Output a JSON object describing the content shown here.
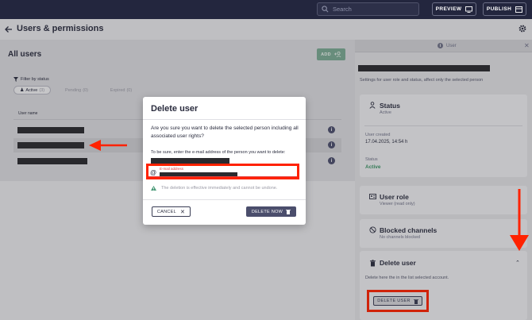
{
  "topbar": {
    "search_placeholder": "Search",
    "preview_label": "PREVIEW",
    "publish_label": "PUBLISH"
  },
  "header": {
    "title": "Users & permissions"
  },
  "list": {
    "title": "All users",
    "add_label": "ADD",
    "filter_label": "Filter by status",
    "chips": [
      {
        "label": "Active",
        "count": "(3)"
      },
      {
        "label": "Pending",
        "count": "(0)"
      },
      {
        "label": "Expired",
        "count": "(0)"
      }
    ],
    "column_header": "User name"
  },
  "right_panel": {
    "tab_label": "User",
    "description": "Settings for user role and status, affect only the selected person",
    "status": {
      "title": "Status",
      "subtitle": "Active",
      "created_label": "User created",
      "created_value": "17.04.2025, 14:54 h",
      "status_label": "Status",
      "status_value": "Active"
    },
    "role": {
      "title": "User role",
      "subtitle": "Viewer (read only)"
    },
    "blocked": {
      "title": "Blocked channels",
      "subtitle": "No channels blocked"
    },
    "delete": {
      "title": "Delete user",
      "text": "Delete here the in the list selected account.",
      "button_label": "DELETE USER"
    }
  },
  "modal": {
    "title": "Delete user",
    "question": "Are you sure you want to delete the selected person including all associated user rights?",
    "instruction": "To be sure, enter the e-mail address of the person you want to delete:",
    "field_label": "E-mail address",
    "warning": "The deletion is effective immediately and cannot be undone.",
    "cancel_label": "CANCEL",
    "delete_now_label": "DELETE NOW"
  },
  "colors": {
    "topbar": "#23263e",
    "accent_green": "#7aaa92",
    "primary_button": "#4b4e6c",
    "annotation_red": "#ff2200",
    "active_status": "#3d9466"
  }
}
